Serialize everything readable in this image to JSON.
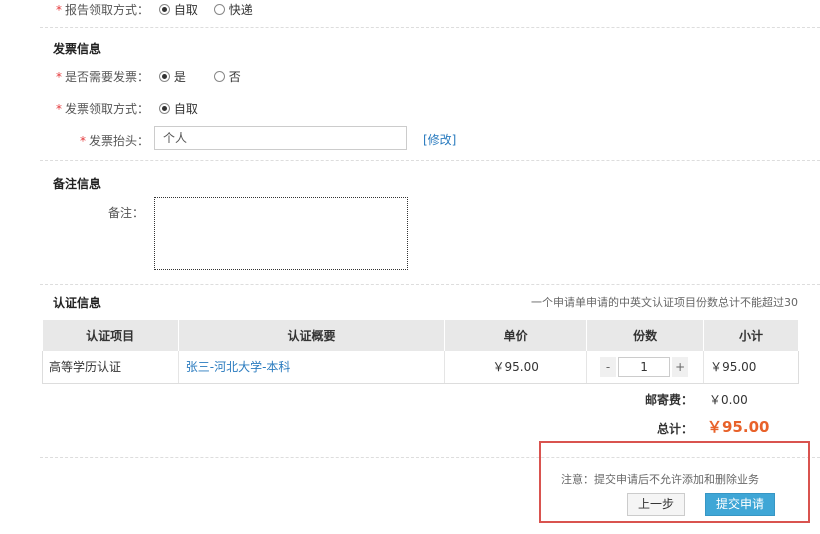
{
  "report_pickup": {
    "label": "报告领取方式：",
    "options": [
      "自取",
      "快递"
    ],
    "selected": "自取"
  },
  "invoice": {
    "title": "发票信息",
    "need_label": "是否需要发票：",
    "need_options": [
      "是",
      "否"
    ],
    "need_selected": "是",
    "pickup_label": "发票领取方式：",
    "pickup_option": "自取",
    "header_label": "发票抬头：",
    "header_value": "个人",
    "modify_link": "[修改]"
  },
  "remarks": {
    "title": "备注信息",
    "label": "备注：",
    "value": ""
  },
  "certification": {
    "title": "认证信息",
    "note": "一个申请单申请的中英文认证项目份数总计不能超过30",
    "columns": [
      "认证项目",
      "认证概要",
      "单价",
      "份数",
      "小计"
    ],
    "rows": [
      {
        "item": "高等学历认证",
        "summary": "张三-河北大学-本科",
        "price": "￥95.00",
        "quantity": "1",
        "subtotal": "￥95.00"
      }
    ],
    "qty_minus": "-",
    "qty_plus": "+"
  },
  "totals": {
    "postage_label": "邮寄费：",
    "postage_value": "￥0.00",
    "total_label": "总计：",
    "total_value": "￥95.00"
  },
  "footer": {
    "notice": "注意：提交申请后不允许添加和删除业务",
    "prev_button": "上一步",
    "submit_button": "提交申请",
    "highlight_color": "#d9534f"
  },
  "colors": {
    "accent": "#3fa6d6",
    "total": "#e8622a",
    "link": "#2a7bbf",
    "required": "#e4393c"
  }
}
